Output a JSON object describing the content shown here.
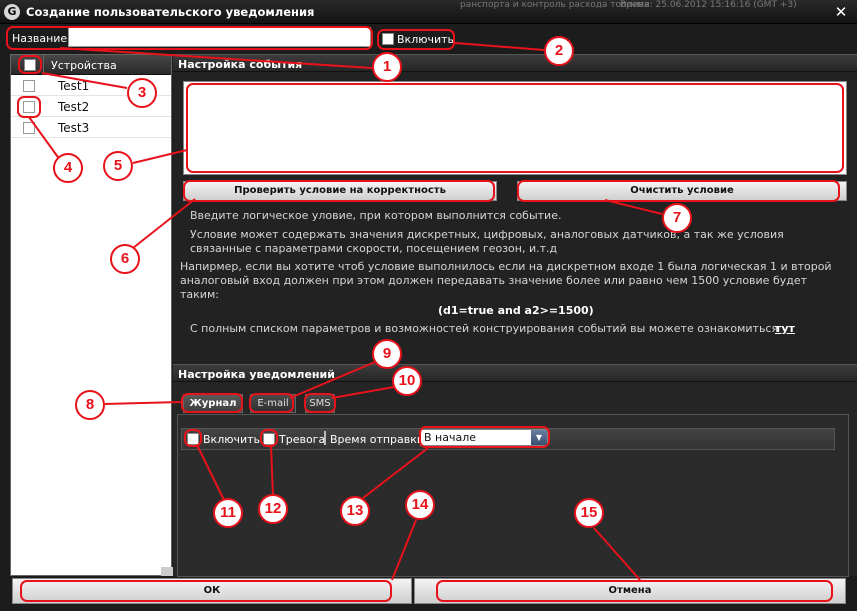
{
  "window": {
    "title": "Создание пользовательского уведомления",
    "bg_left_fragment": "ранспорта и контроль расхода топлива",
    "bg_right_fragment": "Время: 25.06.2012 15:16:16 (GMT +3)",
    "close_glyph": "✕",
    "icon_glyph": "G"
  },
  "name_row": {
    "label": "Название:",
    "value": "",
    "enable_label": "Включить"
  },
  "devices": {
    "header": "Устройства",
    "items": [
      {
        "label": "Test1"
      },
      {
        "label": "Test2"
      },
      {
        "label": "Test3"
      }
    ]
  },
  "event": {
    "header": "Настройка события",
    "condition_value": "",
    "check_button": "Проверить условие на корректность",
    "clear_button": "Очистить условие",
    "help_line1": "Введите логическое уловие, при котором выполнится событие.",
    "help_line2": "Условие может содержать значения дискретных, цифровых, аналоговых датчиков, а так же условия связанные с параметрами скорости, посещением геозон, и.т.д",
    "help_line3": "Напирмер, если вы хотите чтоб условие выполнилось если на дискретном входе 1 была логическая 1 и второй аналоговый вход должен при этом должен передавать значение более или равно чем 1500 условие будет таким:",
    "formula": "(d1=true and a2>=1500)",
    "help_line4": "С полным списком параметров и возможностей конструирования событий вы можете ознакомиться",
    "help_link": "тут"
  },
  "notifications": {
    "header": "Настройка уведомлений",
    "tabs": [
      {
        "label": "Журнал"
      },
      {
        "label": "E-mail"
      },
      {
        "label": "SMS"
      }
    ],
    "enable_label": "Включить",
    "alarm_label": "Тревога",
    "send_time_label": "Время отправки:",
    "send_time_value": "В начале",
    "dropdown_glyph": "▼"
  },
  "footer": {
    "ok": "ОК",
    "cancel": "Отмена"
  },
  "annotations": [
    "1",
    "2",
    "3",
    "4",
    "5",
    "6",
    "7",
    "8",
    "9",
    "10",
    "11",
    "12",
    "13",
    "14",
    "15"
  ],
  "colors": {
    "annotation_red": "#e8121b",
    "window_bg": "#1c1c1c",
    "header_bg": "#2f2f2f"
  }
}
